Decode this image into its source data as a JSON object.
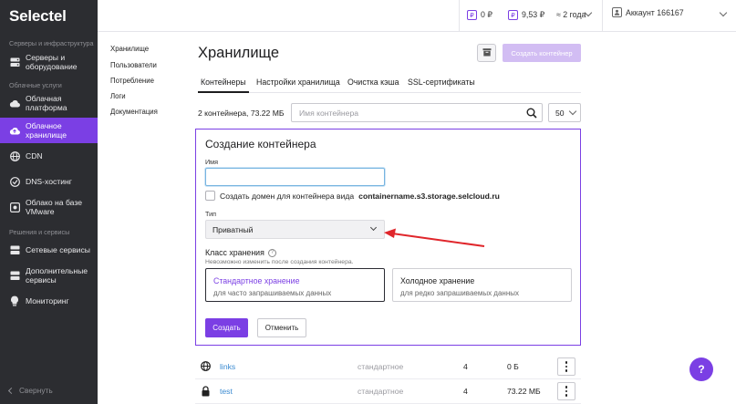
{
  "app": {
    "logo": "Selectel"
  },
  "sidebar": {
    "sections": [
      {
        "title": "Серверы и инфраструктура"
      },
      {
        "title": "Облачные услуги"
      },
      {
        "title": "Решения и сервисы"
      }
    ],
    "items": [
      {
        "label": "Серверы и оборудование",
        "icon": "server-icon"
      },
      {
        "label": "Облачная платформа",
        "icon": "cloud-icon"
      },
      {
        "label": "Облачное хранилище",
        "icon": "cloud-upload-icon",
        "active": true
      },
      {
        "label": "CDN",
        "icon": "globe-icon"
      },
      {
        "label": "DNS-хостинг",
        "icon": "dns-icon"
      },
      {
        "label": "Облако на базе VMware",
        "icon": "vmware-cloud-icon"
      },
      {
        "label": "Сетевые сервисы",
        "icon": "network-icon"
      },
      {
        "label": "Дополнительные сервисы",
        "icon": "services-icon"
      },
      {
        "label": "Мониторинг",
        "icon": "monitoring-icon"
      }
    ],
    "collapse_label": "Свернуть"
  },
  "topbar": {
    "balance_1": "0 ₽",
    "balance_2": "9,53 ₽",
    "forecast": "≈ 2 года",
    "account": "Аккаунт 166167"
  },
  "subnav": {
    "items": [
      "Хранилище",
      "Пользователи",
      "Потребление",
      "Логи",
      "Документация"
    ]
  },
  "main": {
    "title": "Хранилище",
    "create_button": "Создать контейнер",
    "tabs": [
      "Контейнеры",
      "Настройки хранилища",
      "Очистка кэша",
      "SSL-сертификаты"
    ],
    "summary": "2 контейнера, 73.22 МБ",
    "search_placeholder": "Имя контейнера",
    "per_page": "50"
  },
  "create_panel": {
    "heading": "Создание контейнера",
    "name_label": "Имя",
    "name_value": "",
    "domain_checkbox_prefix": "Создать домен для контейнера вида",
    "domain_checkbox_domain": "containername.s3.storage.selcloud.ru",
    "domain_checked": false,
    "type_label": "Тип",
    "type_value": "Приватный",
    "storage_class_label": "Класс хранения",
    "storage_class_hint": "Невозможно изменить после создания контейнера.",
    "storage_options": [
      {
        "title": "Стандартное хранение",
        "desc": "для часто запрашиваемых данных",
        "selected": true
      },
      {
        "title": "Холодное хранение",
        "desc": "для редко запрашиваемых данных",
        "selected": false
      }
    ],
    "submit_label": "Создать",
    "cancel_label": "Отменить"
  },
  "containers": [
    {
      "name": "links",
      "class": "стандартное",
      "objects": "4",
      "size": "0 Б",
      "icon": "globe-icon"
    },
    {
      "name": "test",
      "class": "стандартное",
      "objects": "4",
      "size": "73.22 МБ",
      "icon": "lock-icon"
    }
  ],
  "help_label": "?",
  "colors": {
    "accent": "#7b3fe4",
    "sidebar_bg": "#2c2d31",
    "annotation_arrow": "#e0262b",
    "link": "#3a8ad1"
  }
}
